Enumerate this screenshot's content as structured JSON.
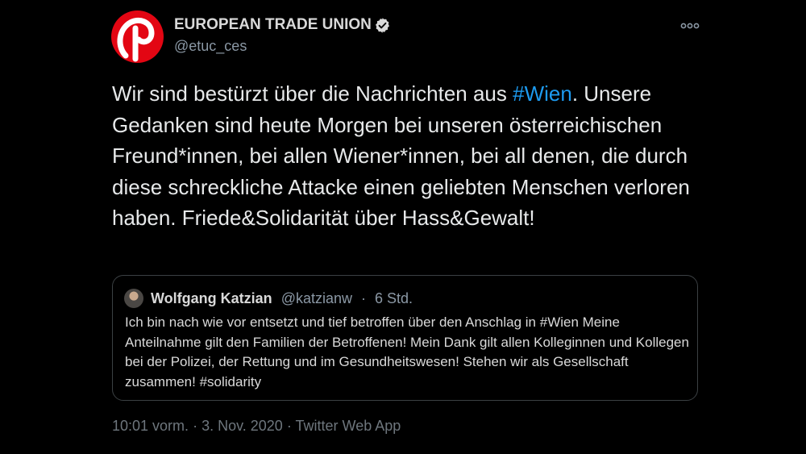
{
  "tweet": {
    "author_name": "EUROPEAN TRADE UNION",
    "handle": "@etuc_ces",
    "text_before": "Wir sind bestürzt über die Nachrichten aus ",
    "hashtag": "#Wien",
    "text_after": ". Unsere Gedanken sind heute Morgen bei unseren österreichischen Freund*innen, bei allen Wiener*innen, bei all denen, die durch diese schreckliche Attacke einen geliebten Menschen verloren haben. Friede&Solidarität über Hass&Gewalt!",
    "time": "10:01 vorm.",
    "date": "3. Nov. 2020",
    "separator": "·",
    "source": "Twitter Web App"
  },
  "quote": {
    "author_name": "Wolfgang Katzian",
    "handle": "@katzianw",
    "separator": "·",
    "age": "6 Std.",
    "text": "Ich bin nach wie vor entsetzt und tief betroffen über den Anschlag in #Wien Meine Anteilnahme gilt den Familien der Betroffenen! Mein Dank gilt allen Kolleginnen und Kollegen bei der Polizei, der Rettung und im Gesundheitswesen! Stehen wir als Gesellschaft zusammen! #solidarity"
  },
  "icons": {
    "avatar": "etuc-logo-icon",
    "verified": "verified-badge-icon",
    "more": "more-options-icon"
  },
  "colors": {
    "background": "#000000",
    "text": "#e7e9ea",
    "hashtag": "#1d9bf0",
    "muted": "#8b98a5",
    "logo_red": "#e30613",
    "border": "#3b4043"
  }
}
